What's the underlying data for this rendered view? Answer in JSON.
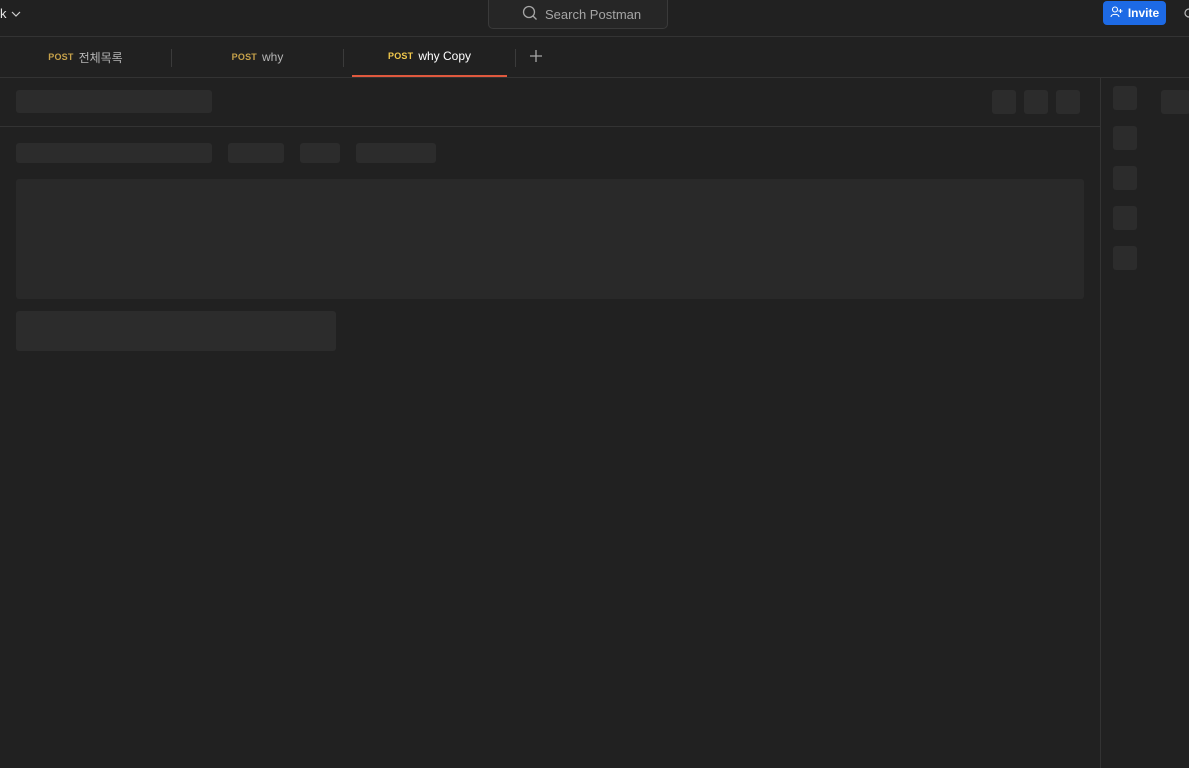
{
  "workspace": {
    "name": "k",
    "chevron_icon": "chevron-down-icon"
  },
  "search": {
    "label": "Search Postman",
    "icon": "search-icon"
  },
  "invite": {
    "label": "Invite",
    "icon": "add-user-icon"
  },
  "tabs": [
    {
      "method": "POST",
      "name": "전체목록",
      "active": false
    },
    {
      "method": "POST",
      "name": "why",
      "active": false
    },
    {
      "method": "POST",
      "name": "why Copy",
      "active": true
    }
  ],
  "new_tab": {
    "label": "+"
  },
  "colors": {
    "background": "#212121",
    "accent": "#1d6ae5",
    "active_tab_underline": "#e0593e",
    "method_post": "#c7a24a"
  }
}
